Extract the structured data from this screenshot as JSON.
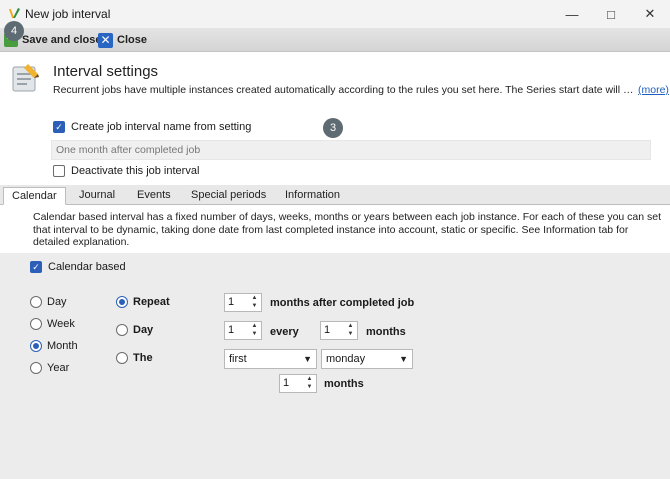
{
  "window": {
    "title": "New job interval",
    "icon": "app-logo-icon",
    "controls": [
      "minimize-icon",
      "maximize-icon",
      "close-icon"
    ]
  },
  "toolbar": {
    "save_label": "Save and close",
    "close_label": "Close",
    "badge": "4"
  },
  "header": {
    "title": "Interval settings",
    "description": "Recurrent jobs have multiple instances created automatically according to the rules you set here. The Series start date will d...",
    "more_link": "(more)",
    "badge": "3"
  },
  "settings": {
    "create_name_label": "Create job interval name from setting",
    "create_name_checked": true,
    "name_value": "One month after completed job",
    "deactivate_label": "Deactivate this job interval",
    "deactivate_checked": false
  },
  "tabs": [
    "Calendar",
    "Journal",
    "Events",
    "Special periods",
    "Information"
  ],
  "active_tab": "Calendar",
  "calendar": {
    "info": "Calendar based interval has a fixed number of days, weeks, months or years between each job instance. For each of these you can set that interval to be dynamic, taking done date from last completed instance into account, static or specific. See Information tab for detailed explanation.",
    "based_label": "Calendar based",
    "based_checked": true,
    "periods": [
      "Day",
      "Week",
      "Month",
      "Year"
    ],
    "selected_period": "Month",
    "modes": [
      "Repeat",
      "Day",
      "The"
    ],
    "selected_mode": "Repeat",
    "repeat": {
      "value": "1",
      "suffix": "months after completed job"
    },
    "day": {
      "value": "1",
      "every_label": "every",
      "months_value": "1",
      "months_label": "months"
    },
    "the": {
      "ordinal": "first",
      "weekday": "monday",
      "months_value": "1",
      "months_label": "months"
    }
  },
  "colors": {
    "accent": "#2b5fb8",
    "badge": "#5f6b73",
    "link": "#1f5fbf"
  }
}
